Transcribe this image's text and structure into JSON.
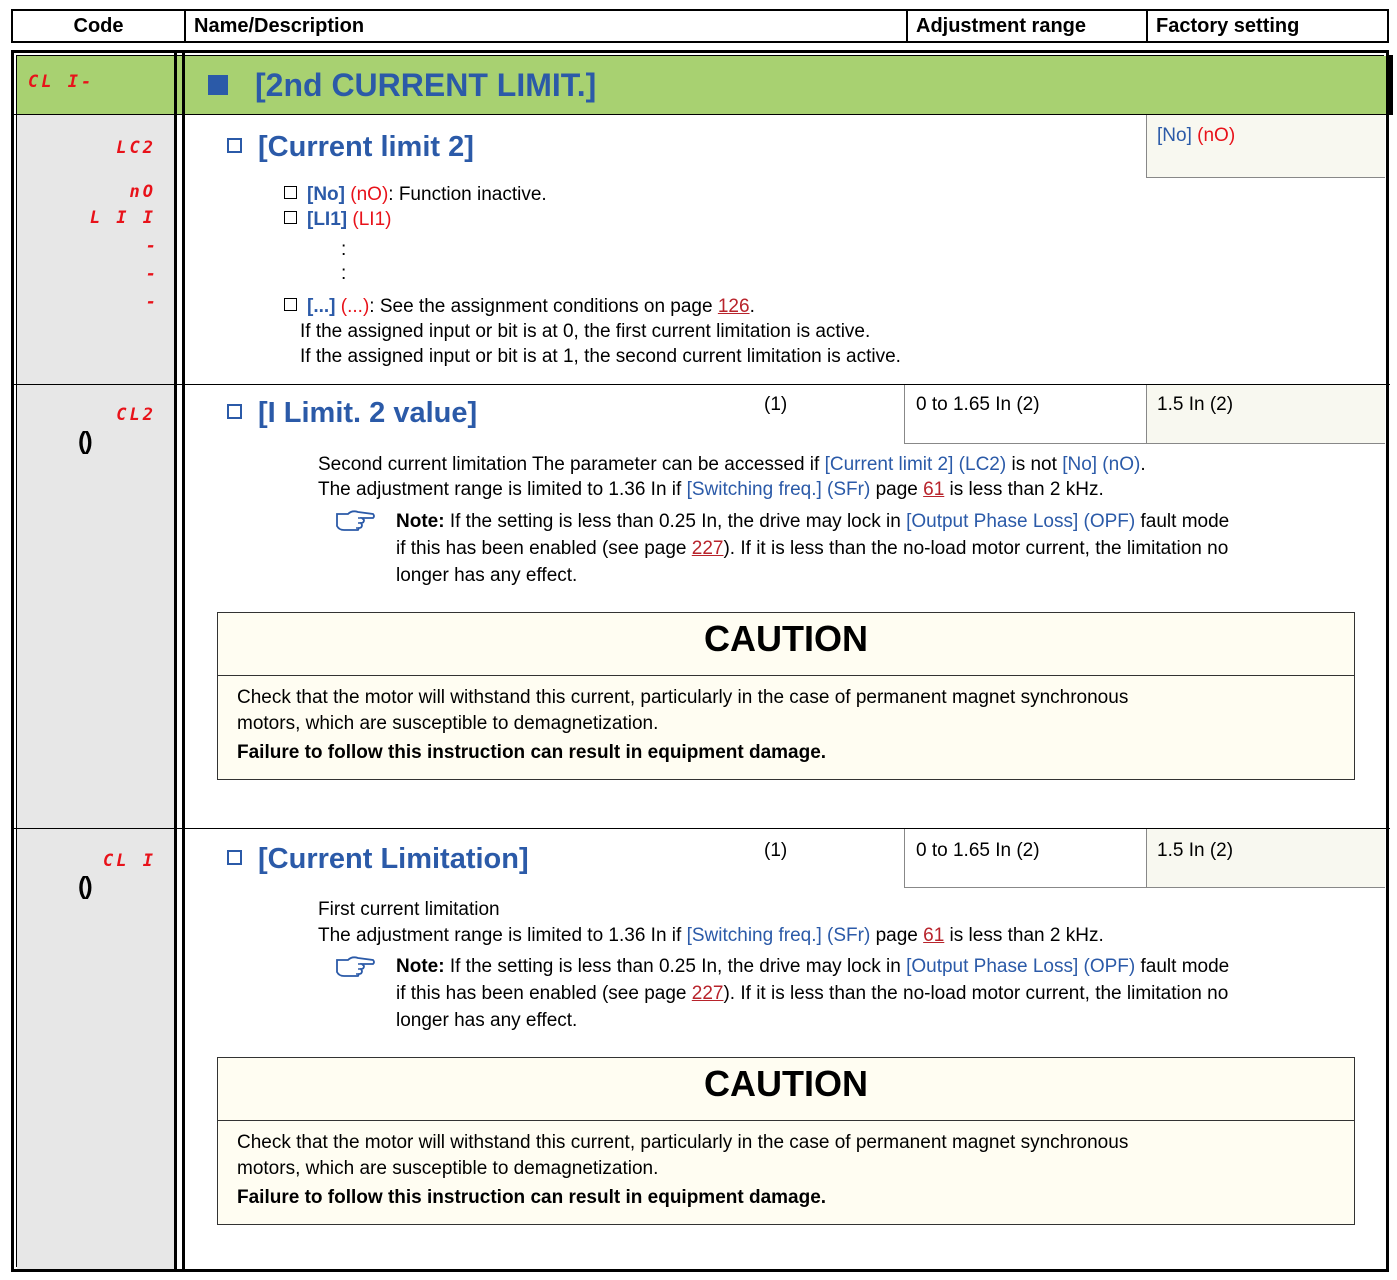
{
  "header": {
    "code": "Code",
    "name": "Name/Description",
    "range": "Adjustment range",
    "factory": "Factory setting"
  },
  "menu": {
    "code": "CL I-",
    "title": "[2nd CURRENT LIMIT.]"
  },
  "lc2": {
    "code": "LC2",
    "name": "[Current limit 2]",
    "factory_label": "[No]",
    "factory_code": "(nO)",
    "codes": [
      "nO",
      "L I I",
      "-",
      "-",
      "-"
    ],
    "opt_no_label": "[No]",
    "opt_no_code": "(nO)",
    "opt_no_desc": ": Function inactive.",
    "opt_li1_label": "[LI1]",
    "opt_li1_code": "(LI1)",
    "dots": [
      ":",
      ":"
    ],
    "opt_more_label": "[...]",
    "opt_more_code": "(...)",
    "opt_more_desc": ": See the assignment conditions on page ",
    "opt_more_page": "126",
    "line1": "If the assigned input or bit is at 0, the first current limitation is active.",
    "line2": "If the assigned input or bit is at 1, the second current limitation is active."
  },
  "cl2": {
    "code": "CL2",
    "name": "[I Limit. 2 value]",
    "note_ref": "(1)",
    "range": "0 to 1.65 In (2)",
    "factory": "1.5 In (2)",
    "desc_a": "Second current limitation The parameter can be accessed if ",
    "desc_b": "[Current limit 2] (LC2)",
    "desc_c": " is not ",
    "desc_d": "[No] (nO)",
    "desc_e": ".",
    "adj_a": "The adjustment range is limited to 1.36 In if ",
    "adj_b": "[Switching freq.] (SFr)",
    "adj_c": " page ",
    "adj_page": "61",
    "adj_d": " is less than 2 kHz.",
    "note_label": "Note:",
    "note_a": "If the setting is less than 0.25 In, the drive may lock in ",
    "note_b": "[Output Phase Loss] (OPF)",
    "note_c": " fault mode",
    "note_line2a": "if this has been enabled (see page ",
    "note_page": "227",
    "note_line2b": "). If it is less than the no-load motor current, the limitation no",
    "note_line3": "longer has any effect.",
    "caution_title": "CAUTION",
    "caution_line1": "Check that the motor will withstand this current, particularly in the case of permanent magnet synchronous",
    "caution_line2": "motors, which are susceptible to demagnetization.",
    "caution_bold": "Failure to follow this instruction can result in equipment damage."
  },
  "cl1": {
    "code": "CL I",
    "name": "[Current Limitation]",
    "note_ref": "(1)",
    "range": "0 to 1.65 In (2)",
    "factory": "1.5 In (2)",
    "desc": "First current limitation",
    "adj_a": "The adjustment range is limited to 1.36 In if ",
    "adj_b": "[Switching freq.] (SFr)",
    "adj_c": " page ",
    "adj_page": "61",
    "adj_d": " is less than 2 kHz.",
    "note_label": "Note:",
    "note_a": "If the setting is less than 0.25 In, the drive may lock in ",
    "note_b": "[Output Phase Loss] (OPF)",
    "note_c": " fault mode",
    "note_line2a": "if this has been enabled (see page ",
    "note_page": "227",
    "note_line2b": "). If it is less than the no-load motor current, the limitation no",
    "note_line3": "longer has any effect.",
    "caution_title": "CAUTION",
    "caution_line1": "Check that the motor will withstand this current, particularly in the case of permanent magnet synchronous",
    "caution_line2": "motors, which are susceptible to demagnetization.",
    "caution_bold": "Failure to follow this instruction can result in equipment damage."
  },
  "colors": {
    "menu_band": "#a8d171",
    "code_column": "#e7e7e7",
    "factory_cell": "#f8f8f0",
    "caution_bg": "#fffdf2",
    "param_blue": "#2b5aa8",
    "code_red": "#e8121a"
  },
  "icons": [
    "note-hand-icon",
    "adjustable-icon"
  ]
}
